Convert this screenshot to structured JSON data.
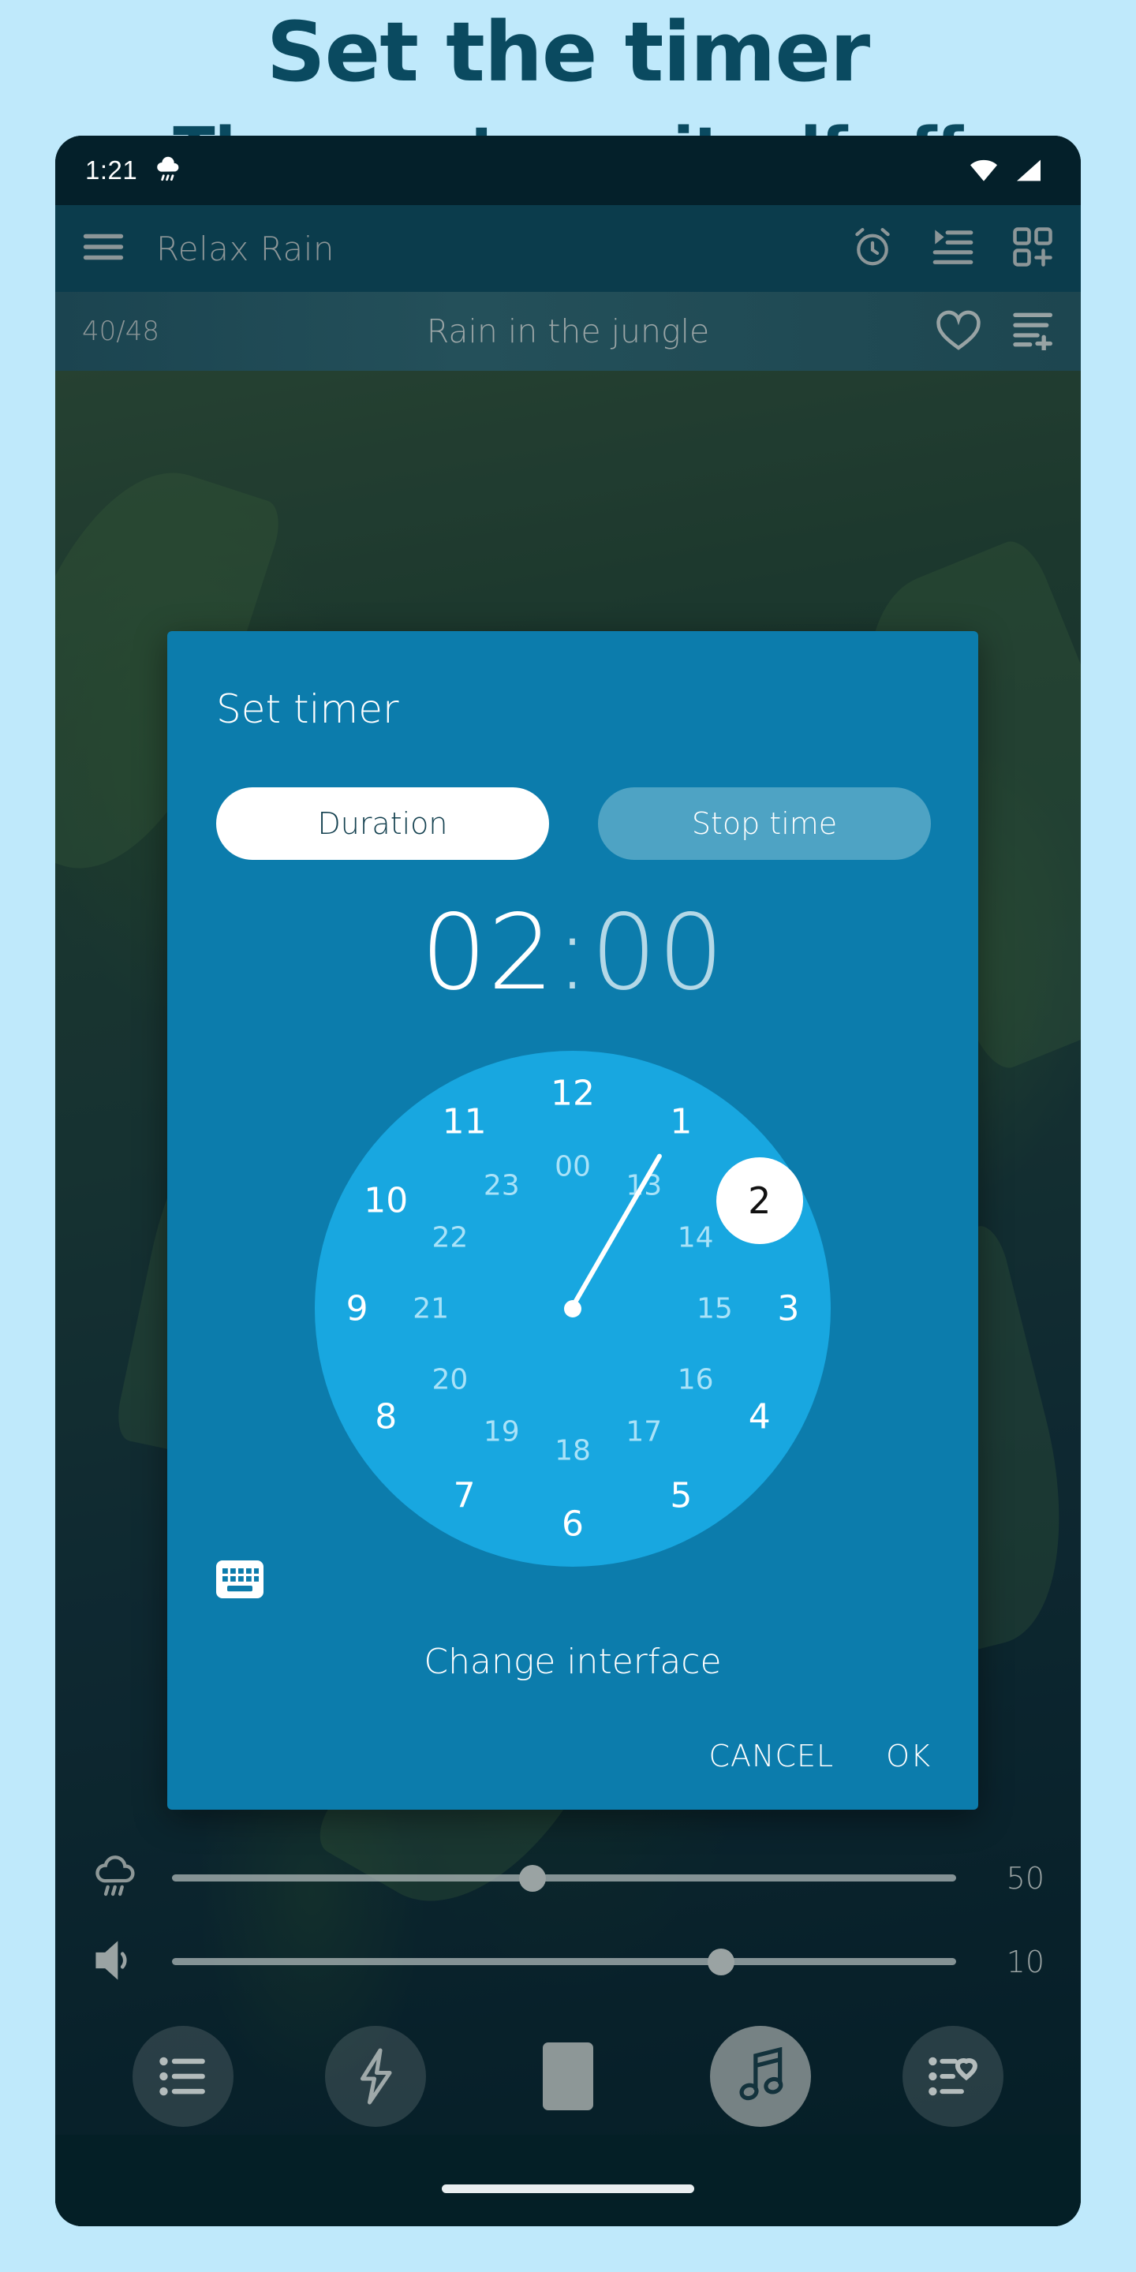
{
  "promo": {
    "title": "Set the timer",
    "subtitle": "The app turns itself off"
  },
  "status_bar": {
    "time": "1:21",
    "weather_icon": "rain-cloud-icon",
    "wifi_icon": "wifi-icon",
    "signal_icon": "cellular-signal-icon"
  },
  "app_bar": {
    "menu_icon": "hamburger-menu-icon",
    "title": "Relax Rain",
    "icons": [
      "alarm-clock-icon",
      "playlist-play-icon",
      "add-grid-icon"
    ]
  },
  "track_bar": {
    "count": "40/48",
    "title": "Rain in the jungle",
    "favorite_icon": "heart-outline-icon",
    "add_to_playlist_icon": "playlist-add-icon"
  },
  "dialog": {
    "title": "Set timer",
    "tabs": [
      {
        "label": "Duration",
        "selected": true
      },
      {
        "label": "Stop time",
        "selected": false
      }
    ],
    "time": {
      "hours": "02",
      "separator": ":",
      "minutes": "00",
      "active_field": "hours"
    },
    "clock": {
      "mode": "24-hour",
      "selected_value": "2",
      "outer_ring": [
        "12",
        "1",
        "2",
        "3",
        "4",
        "5",
        "6",
        "7",
        "8",
        "9",
        "10",
        "11"
      ],
      "inner_ring": [
        "00",
        "13",
        "14",
        "15",
        "16",
        "17",
        "18",
        "19",
        "20",
        "21",
        "22",
        "23"
      ]
    },
    "keyboard_icon": "keyboard-icon",
    "change_interface_label": "Change interface",
    "cancel_label": "CANCEL",
    "ok_label": "OK"
  },
  "controls": {
    "rain_slider": {
      "icon": "rain-cloud-icon",
      "value": "50",
      "percent": 46
    },
    "volume_slider": {
      "icon": "volume-icon",
      "value": "10",
      "percent": 70
    }
  },
  "nav": [
    {
      "name": "sound-list-icon",
      "active": false
    },
    {
      "name": "lightning-icon",
      "active": false
    },
    {
      "name": "stop-icon",
      "active": false,
      "plain": true
    },
    {
      "name": "music-note-icon",
      "active": true
    },
    {
      "name": "favorites-list-icon",
      "active": false
    }
  ],
  "colors": {
    "promo_bg": "#bfe9fb",
    "promo_text": "#0a4a60",
    "dialog_bg": "#0c7cac",
    "clock_face": "#18a7e0",
    "accent_white": "#ffffff",
    "inner_ring_text": "#a9e2f8",
    "appbar_bg": "#0b3c4c"
  }
}
